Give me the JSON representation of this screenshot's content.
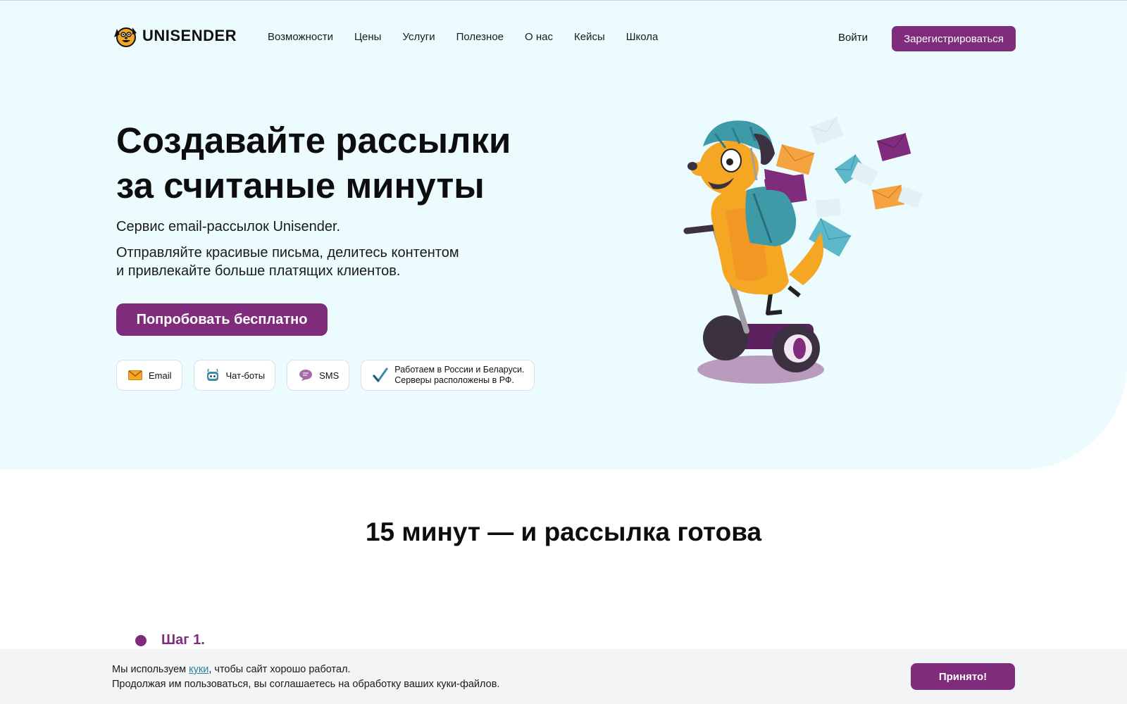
{
  "colors": {
    "brand": "#7f2c7c",
    "hero_bg": "#ecfbfe",
    "link": "#2d7ea0"
  },
  "header": {
    "logo_text": "UNISENDER",
    "logo_icon": "dog-mascot-icon",
    "nav": [
      "Возможности",
      "Цены",
      "Услуги",
      "Полезное",
      "О нас",
      "Кейсы",
      "Школа"
    ],
    "login_label": "Войти",
    "register_label": "Зарегистрироваться"
  },
  "hero": {
    "title_line1": "Создавайте рассылки",
    "title_line2": "за считаные минуты",
    "subtitle": "Сервис email-рассылок Unisender.",
    "desc_line1": "Отправляйте красивые письма, делитесь контентом",
    "desc_line2": "и привлекайте больше платящих клиентов.",
    "cta_label": "Попробовать бесплатно",
    "chips": [
      {
        "label": "Email",
        "icon": "envelope-icon"
      },
      {
        "label": "Чат-боты",
        "icon": "robot-icon"
      },
      {
        "label": "SMS",
        "icon": "chat-bubble-icon"
      }
    ],
    "note_line1": "Работаем в России и Беларуси.",
    "note_line2": "Серверы расположены в РФ.",
    "note_icon": "checkmark-icon",
    "illustration": "dog-on-segway-illustration"
  },
  "section": {
    "title": "15 минут — и рассылка готова",
    "step_label": "Шаг 1."
  },
  "cookie": {
    "text_before": "Мы используем ",
    "link": "куки",
    "text_after": ", чтобы сайт хорошо работал.",
    "line2": "Продолжая им пользоваться, вы соглашаетесь на обработку ваших куки-файлов.",
    "accept_label": "Принято!"
  }
}
